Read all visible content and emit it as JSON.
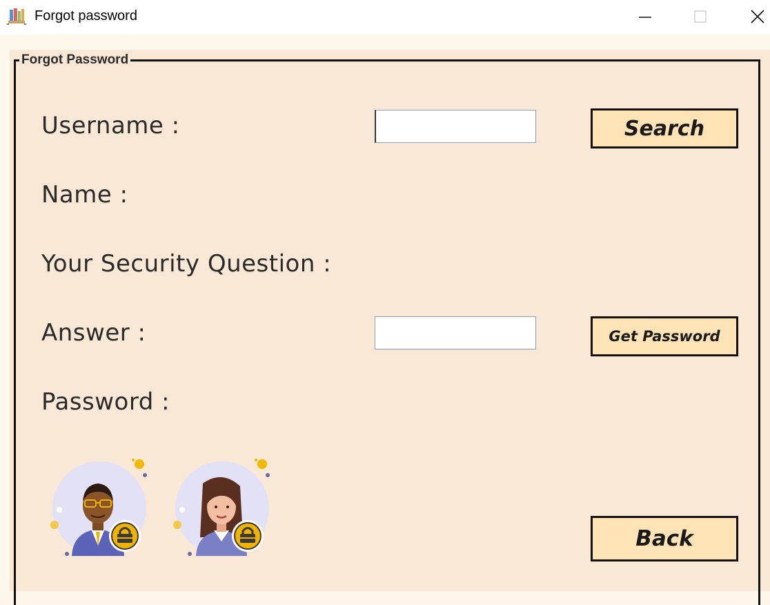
{
  "window": {
    "title": "Forgot password"
  },
  "group": {
    "legend": "Forgot Password"
  },
  "form": {
    "username_label": "Username :",
    "name_label": "Name :",
    "question_label": "Your Security Question :",
    "answer_label": "Answer :",
    "password_label": "Password :",
    "username_value": "",
    "answer_value": ""
  },
  "buttons": {
    "search": "Search",
    "get_password": "Get Password",
    "back": "Back"
  },
  "icons": {
    "app": "library-books-icon",
    "minimize": "minimize-icon",
    "maximize": "maximize-icon",
    "close": "close-icon",
    "avatar_man": "man-lock-avatar-icon",
    "avatar_woman": "woman-lock-avatar-icon"
  },
  "colors": {
    "panel_bg": "#f9e8d5",
    "button_bg": "#fde3b6",
    "avatar_circle": "#e3e1f5",
    "lock_badge": "#f0b400"
  }
}
